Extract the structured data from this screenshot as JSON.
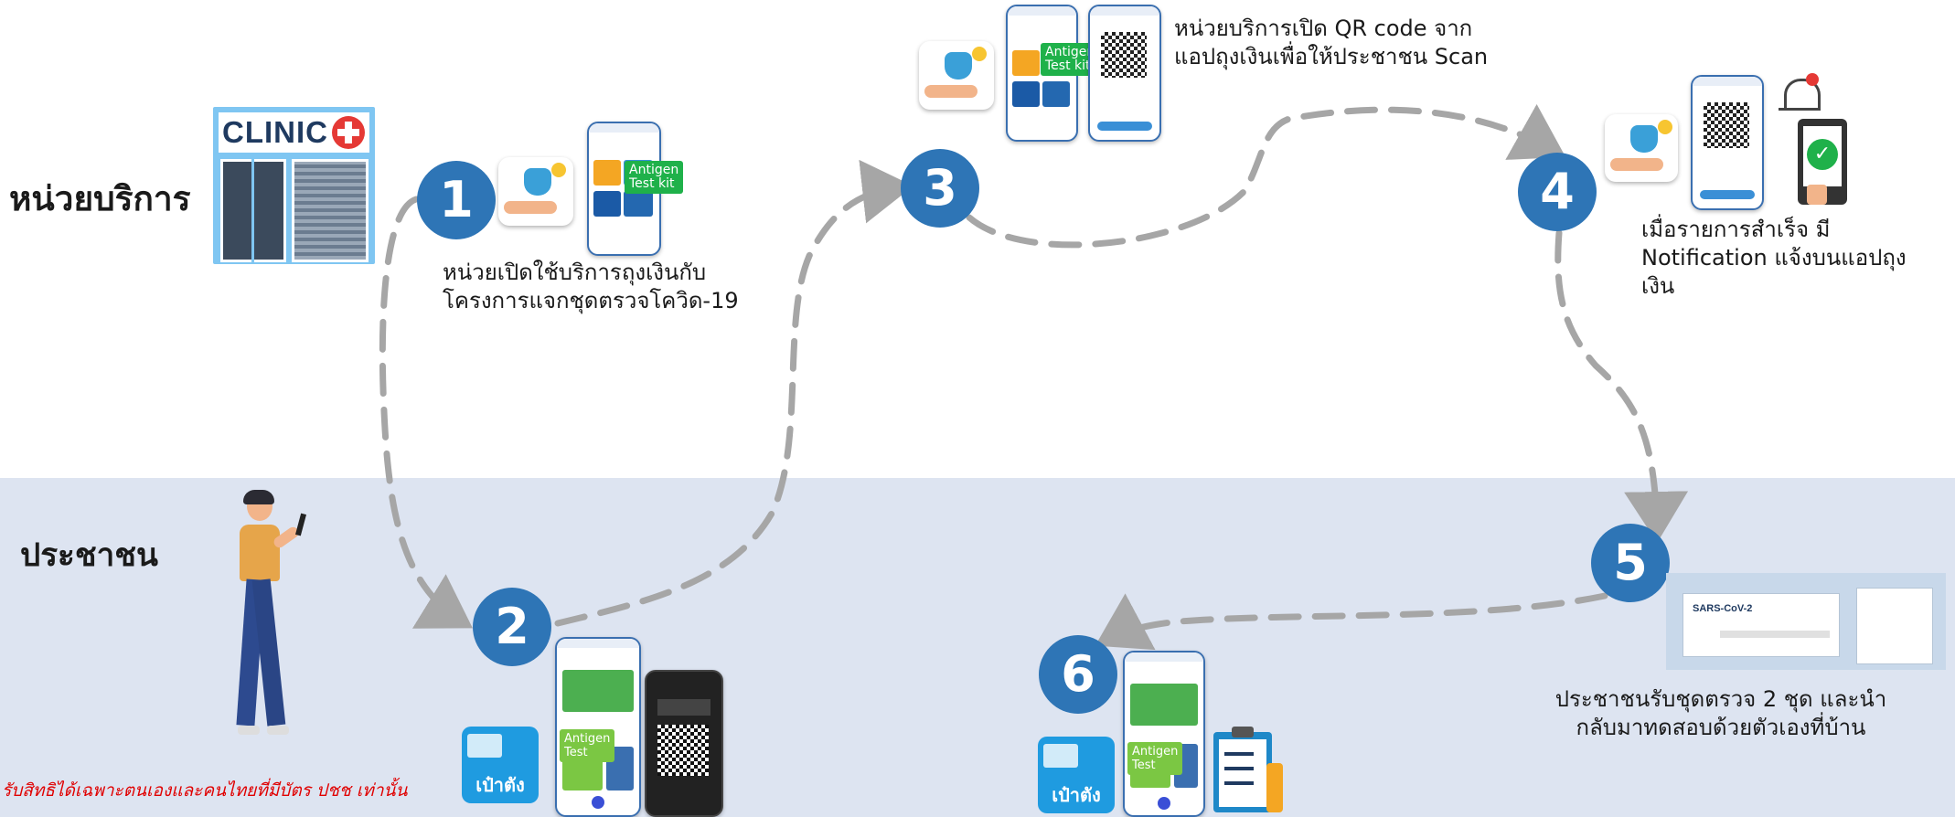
{
  "lanes": {
    "provider": "หน่วยบริการ",
    "public": "ประชาชน"
  },
  "clinic": {
    "sign": "CLINIC"
  },
  "steps": [
    {
      "number": "1",
      "caption": [
        "หน่วยเปิดใช้บริการถุงเงินกับ",
        "โครงการแจกชุดตรวจโควิด-19"
      ]
    },
    {
      "number": "2",
      "caption": []
    },
    {
      "number": "3",
      "caption": [
        "หน่วยบริการเปิด QR code จาก",
        "แอปถุงเงินเพื่อให้ประชาชน Scan"
      ]
    },
    {
      "number": "4",
      "caption": [
        "เมื่อรายการสำเร็จ มี",
        "Notification แจ้งบนแอปถุง",
        "เงิน"
      ]
    },
    {
      "number": "5",
      "caption": [
        "ประชาชนรับชุดตรวจ 2 ชุด และนำ",
        "กลับมาทดสอบด้วยตัวเองที่บ้าน"
      ]
    },
    {
      "number": "6",
      "caption": []
    }
  ],
  "tags": {
    "antigen_kit": [
      "Antigen",
      "Test kit"
    ],
    "antigen_test": [
      "Antigen",
      "Test"
    ]
  },
  "pao_tang_label": "เป๋าตัง",
  "eligibility_note": "รับสิทธิได้เฉพาะตนเองและคนไทยที่มีบัตร ปชช เท่านั้น",
  "kit_box_label": "SARS-CoV-2",
  "colors": {
    "step": "#2e75b6",
    "band": "#dde4f1",
    "arrow": "#a6a6a6",
    "tag": "#1fb14a",
    "note": "#e00000"
  }
}
